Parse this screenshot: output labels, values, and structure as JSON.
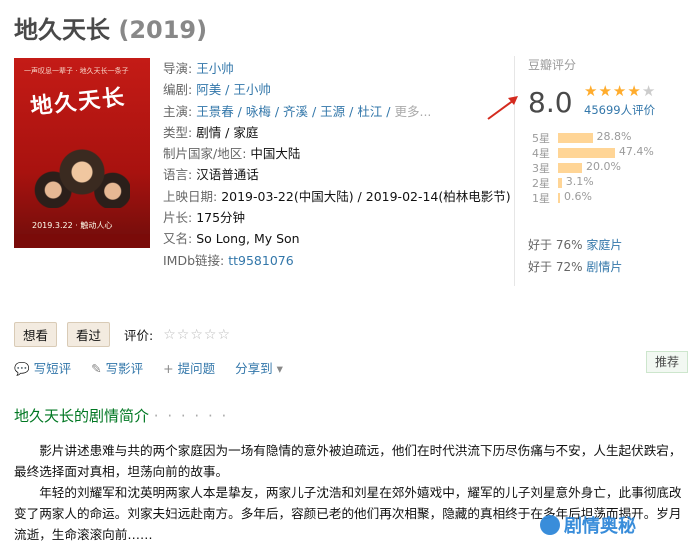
{
  "movie": {
    "title": "地久天长",
    "year": "(2019)",
    "poster": {
      "small_text": "一声叹息一辈子 · 地久天长一条子",
      "title_art": "地久天长",
      "date_text": "2019.3.22 · 触动人心"
    }
  },
  "info": [
    {
      "label": "导演: ",
      "value": "王小帅",
      "type": "link"
    },
    {
      "label": "编剧: ",
      "value": "阿美 / 王小帅",
      "type": "link"
    },
    {
      "label": "主演: ",
      "value": "王景春 / 咏梅 / 齐溪 / 王源 / 杜江 / ",
      "more": "更多...",
      "type": "link"
    },
    {
      "label": "类型: ",
      "value": "剧情 / 家庭",
      "type": "text"
    },
    {
      "label": "制片国家/地区: ",
      "value": "中国大陆",
      "type": "text"
    },
    {
      "label": "语言: ",
      "value": "汉语普通话",
      "type": "text"
    },
    {
      "label": "上映日期: ",
      "value": "2019-03-22(中国大陆) / 2019-02-14(柏林电影节)",
      "type": "text"
    },
    {
      "label": "片长: ",
      "value": "175分钟",
      "type": "text"
    },
    {
      "label": "又名: ",
      "value": "So Long, My Son",
      "type": "text"
    },
    {
      "label": "IMDb链接: ",
      "value": "tt9581076",
      "type": "link"
    }
  ],
  "rating": {
    "label": "豆瓣评分",
    "score": "8.0",
    "stars_filled": 4,
    "stars_total": 5,
    "votes": "45699人评价",
    "distribution": [
      {
        "star": "5星",
        "pct": "28.8%",
        "value": 28.8
      },
      {
        "star": "4星",
        "pct": "47.4%",
        "value": 47.4
      },
      {
        "star": "3星",
        "pct": "20.0%",
        "value": 20.0
      },
      {
        "star": "2星",
        "pct": "3.1%",
        "value": 3.1
      },
      {
        "star": "1星",
        "pct": "0.6%",
        "value": 0.6
      }
    ],
    "better_than": [
      {
        "prefix": "好于 ",
        "pct": "76%",
        "genre": " 家庭片"
      },
      {
        "prefix": "好于 ",
        "pct": "72%",
        "genre": " 剧情片"
      }
    ]
  },
  "actions": {
    "want": "想看",
    "seen": "看过",
    "rate_label": "评价:",
    "rate_stars": "☆☆☆☆☆"
  },
  "toolbar": {
    "short_review": "写短评",
    "review": "写影评",
    "question": "提问题",
    "share": "分享到",
    "recommend": "推荐"
  },
  "summary": {
    "heading": "地久天长的剧情简介",
    "heading_dots": "· · · · · ·",
    "p1": "影片讲述患难与共的两个家庭因为一场有隐情的意外被迫疏远，他们在时代洪流下历尽伤痛与不安，人生起伏跌宕，最终选择面对真相，坦荡向前的故事。",
    "p2": "年轻的刘耀军和沈英明两家人本是挚友，两家儿子沈浩和刘星在郊外嬉戏中，耀军的儿子刘星意外身亡，此事彻底改变了两家人的命运。刘家夫妇远赴南方。多年后，容颜已老的他们再次相聚，隐藏的真相终于在多年后坦荡而揭开。岁月流逝，生命滚滚向前……"
  },
  "watermark": "剧情奥秘",
  "colors": {
    "link": "#3377aa",
    "star": "#ffac2d",
    "green": "#007722",
    "bar": "#ffd596"
  }
}
